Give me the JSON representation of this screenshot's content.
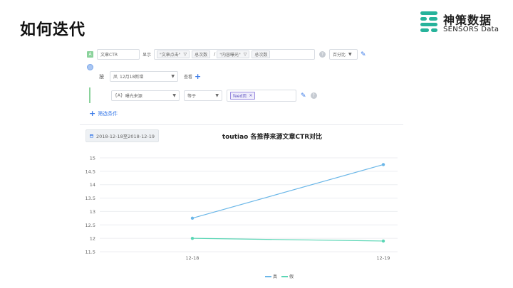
{
  "slide": {
    "title": "如何迭代"
  },
  "logo": {
    "name_cn": "神策数据",
    "name_en": "SENSORS Data",
    "color": "#27b39b"
  },
  "query": {
    "event_badge": "A",
    "event_name": "文章CTR",
    "show_label": "显示",
    "tag1": "\"文章点击\"",
    "metric1": "总次数",
    "divide": "/",
    "tag2": "\"内容曝光\"",
    "metric2": "总次数",
    "format": "百分比",
    "by_label": "按",
    "group_icon": "凤",
    "group_by": "12月18新增",
    "view_label": "查看",
    "filter_icon": "{A}",
    "filter_field": "曝光来源",
    "filter_op": "等于",
    "filter_value": "feed页",
    "add_filter": "筛选条件"
  },
  "chart_header": {
    "date_range": "2018-12-18至2018-12-19",
    "title": "toutiao 各推荐来源文章CTR对比"
  },
  "chart_data": {
    "type": "line",
    "title": "toutiao 各推荐来源文章CTR对比",
    "x": [
      "12-18",
      "12-19"
    ],
    "ylim": [
      11.5,
      15
    ],
    "yticks": [
      15,
      14.5,
      14,
      13.5,
      13,
      12.5,
      12,
      11.5
    ],
    "grid": true,
    "legend_position": "bottom-right",
    "series": [
      {
        "name": "真",
        "values": [
          12.75,
          14.75
        ],
        "color": "#6bb7e8"
      },
      {
        "name": "假",
        "values": [
          12.0,
          11.9
        ],
        "color": "#5bd6b5"
      }
    ]
  }
}
